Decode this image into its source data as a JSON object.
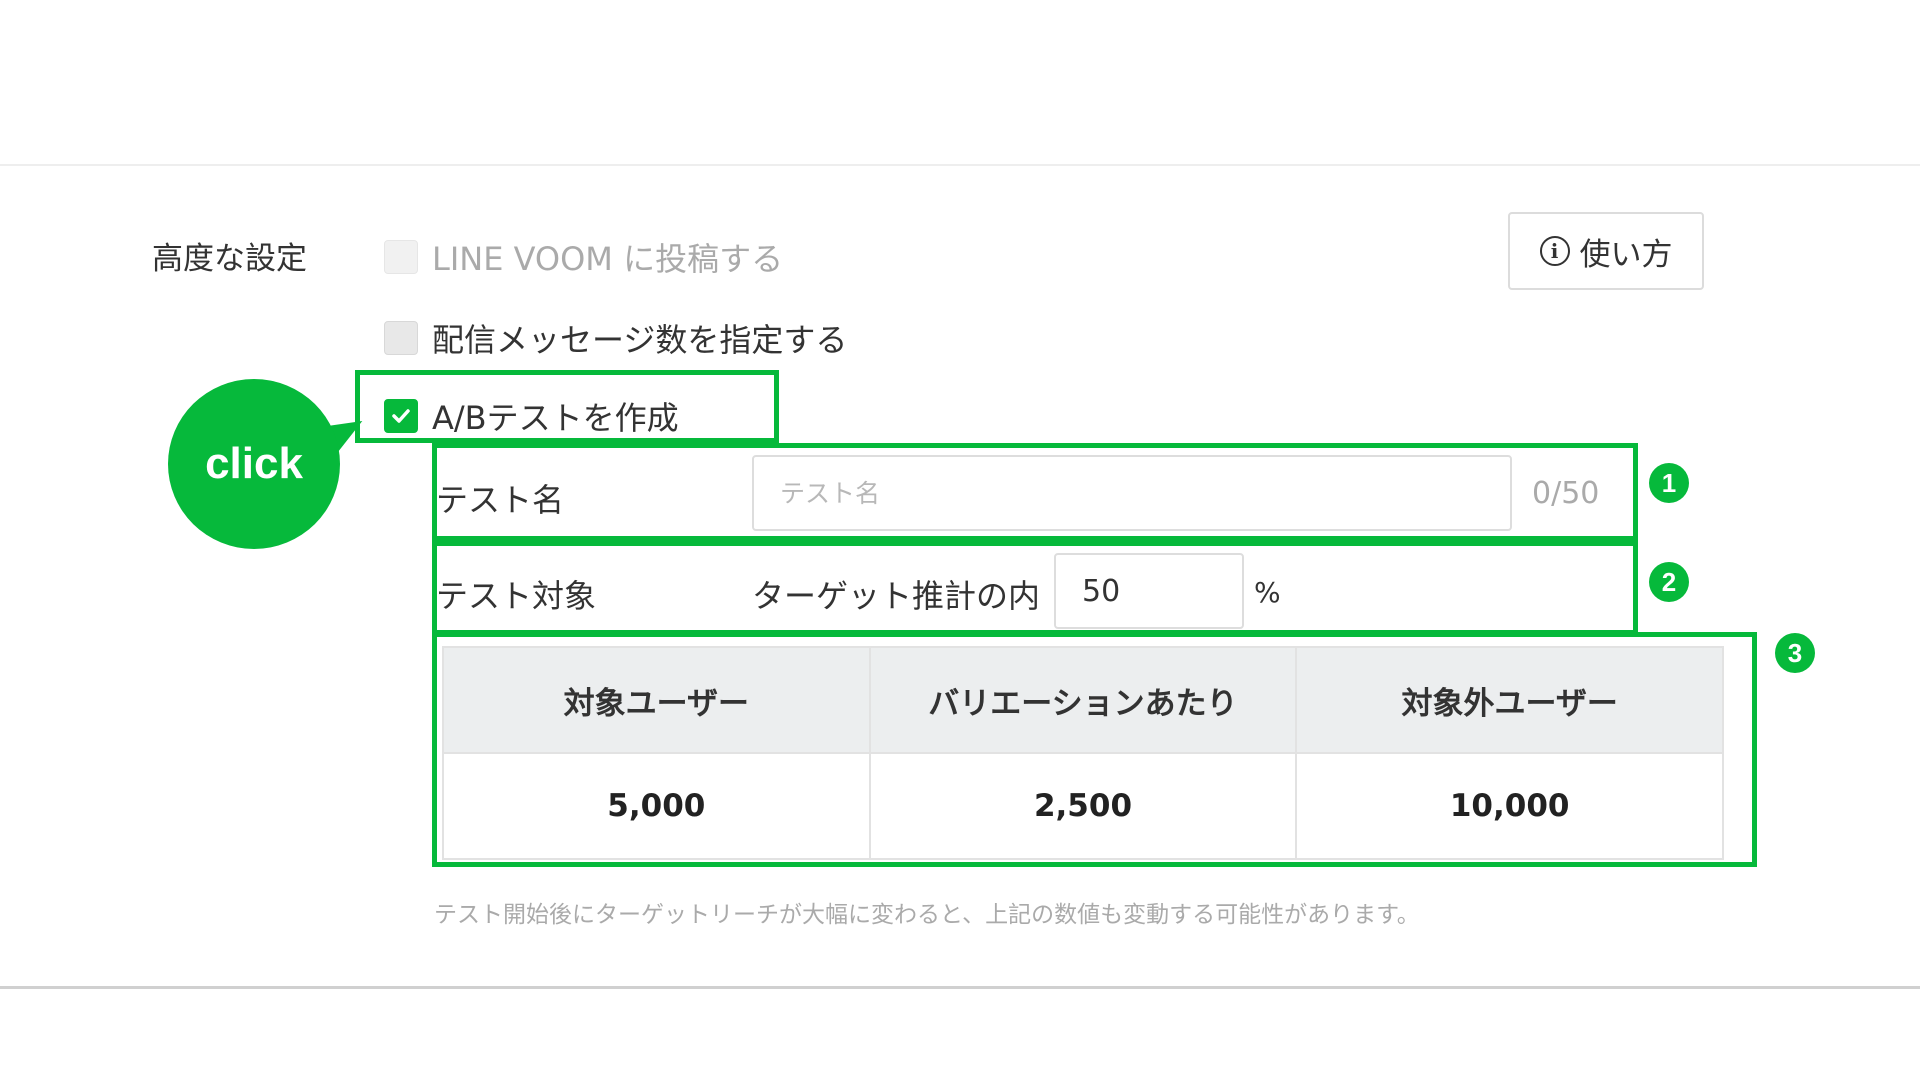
{
  "advanced": {
    "section_label": "高度な設定",
    "help_button": {
      "label": "使い方",
      "icon": "info-icon",
      "icon_glyph": "i"
    },
    "options": [
      {
        "label": "LINE VOOM に投稿する",
        "checked": false,
        "disabled": true
      },
      {
        "label": "配信メッセージ数を指定する",
        "checked": false,
        "disabled": false
      },
      {
        "label": "A/Bテストを作成",
        "checked": true,
        "disabled": false
      }
    ]
  },
  "callout": {
    "text": "click"
  },
  "badges": [
    "1",
    "2",
    "3"
  ],
  "ab_test": {
    "name_label": "テスト名",
    "name_placeholder": "テスト名",
    "name_value": "",
    "name_counter": "0/50",
    "target_label": "テスト対象",
    "target_sub_label": "ターゲット推計の内",
    "target_percent_value": "50",
    "percent_sign": "%",
    "table": {
      "headers": [
        "対象ユーザー",
        "バリエーションあたり",
        "対象外ユーザー"
      ],
      "values": [
        "5,000",
        "2,500",
        "10,000"
      ]
    },
    "note": "テスト開始後にターゲットリーチが大幅に変わると、上記の数値も変動する可能性があります。"
  },
  "colors": {
    "accent": "#06b93b",
    "header_bg": "#eceeef",
    "muted_text": "#aaaaaa"
  }
}
